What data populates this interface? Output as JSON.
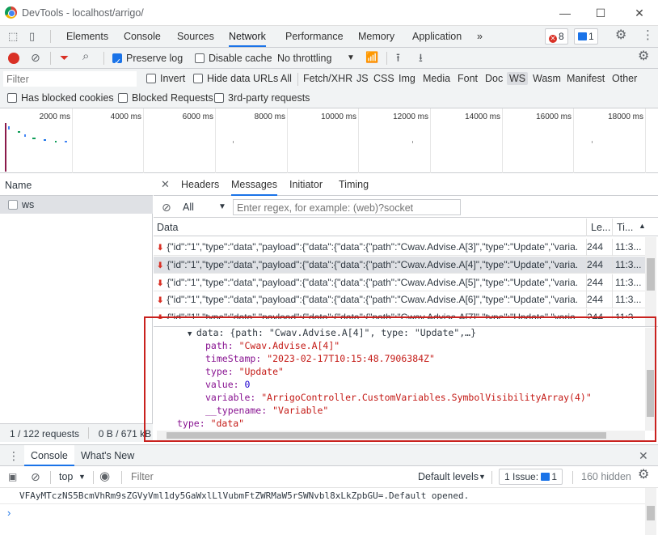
{
  "window": {
    "title": "DevTools - localhost/arrigo/"
  },
  "main_tabs": [
    "Elements",
    "Console",
    "Sources",
    "Network",
    "Performance",
    "Memory",
    "Application"
  ],
  "active_main_tab": "Network",
  "badges": {
    "errors": "8",
    "messages": "1"
  },
  "network_toolbar": {
    "preserve_log": "Preserve log",
    "disable_cache": "Disable cache",
    "throttling": "No throttling"
  },
  "filter": {
    "placeholder": "Filter",
    "invert": "Invert",
    "hide_data_urls": "Hide data URLs",
    "types": [
      "All",
      "Fetch/XHR",
      "JS",
      "CSS",
      "Img",
      "Media",
      "Font",
      "Doc",
      "WS",
      "Wasm",
      "Manifest",
      "Other"
    ],
    "selected_type": "WS",
    "has_blocked_cookies": "Has blocked cookies",
    "blocked_requests": "Blocked Requests",
    "third_party": "3rd-party requests"
  },
  "overview": {
    "ticks": [
      "2000 ms",
      "4000 ms",
      "6000 ms",
      "8000 ms",
      "10000 ms",
      "12000 ms",
      "14000 ms",
      "16000 ms",
      "18000 ms"
    ]
  },
  "request_list": {
    "header": "Name",
    "items": [
      "ws"
    ],
    "status": "1 / 122 requests",
    "transfer": "0 B / 671 kB t"
  },
  "detail_tabs": [
    "Headers",
    "Messages",
    "Initiator",
    "Timing"
  ],
  "active_detail_tab": "Messages",
  "messages_filter": {
    "type": "All",
    "placeholder": "Enter regex, for example: (web)?socket"
  },
  "messages_grid": {
    "columns": [
      "Data",
      "Le...",
      "Ti..."
    ],
    "rows": [
      {
        "data": "{\"id\":\"1\",\"type\":\"data\",\"payload\":{\"data\":{\"data\":{\"path\":\"Cwav.Advise.A[3]\",\"type\":\"Update\",\"varia...",
        "len": "244",
        "time": "11:3..."
      },
      {
        "data": "{\"id\":\"1\",\"type\":\"data\",\"payload\":{\"data\":{\"data\":{\"path\":\"Cwav.Advise.A[4]\",\"type\":\"Update\",\"varia...",
        "len": "244",
        "time": "11:3..."
      },
      {
        "data": "{\"id\":\"1\",\"type\":\"data\",\"payload\":{\"data\":{\"data\":{\"path\":\"Cwav.Advise.A[5]\",\"type\":\"Update\",\"varia...",
        "len": "244",
        "time": "11:3..."
      },
      {
        "data": "{\"id\":\"1\",\"type\":\"data\",\"payload\":{\"data\":{\"data\":{\"path\":\"Cwav.Advise.A[6]\",\"type\":\"Update\",\"varia...",
        "len": "244",
        "time": "11:3..."
      },
      {
        "data": "{\"id\":\"1\",\"type\":\"data\",\"payload\":{\"data\":{\"data\":{\"path\":\"Cwav.Advise.A[7]\",\"type\":\"Update\",\"varia...",
        "len": "244",
        "time": "11:3..."
      }
    ]
  },
  "json_view": {
    "data_line": "data: {path: \"Cwav.Advise.A[4]\", type: \"Update\",…}",
    "path_key": "path:",
    "path_val": "\"Cwav.Advise.A[4]\"",
    "ts_key": "timeStamp:",
    "ts_val": "\"2023-02-17T10:15:48.7906384Z\"",
    "type_key": "type:",
    "type_val": "\"Update\"",
    "value_key": "value:",
    "value_val": "0",
    "var_key": "variable:",
    "var_val": "\"ArrigoController.CustomVariables.SymbolVisibilityArray(4)\"",
    "typename_key": "__typename:",
    "typename_val": "\"Variable\"",
    "outer_type_key": "type:",
    "outer_type_val": "\"data\""
  },
  "drawer": {
    "tabs": [
      "Console",
      "What's New"
    ],
    "context": "top",
    "filter_placeholder": "Filter",
    "levels": "Default levels",
    "issues": "1 Issue:",
    "issues_count": "1",
    "hidden": "160 hidden",
    "log_line": "VFAyMTczNS5BcmVhRm9sZGVyVml1dy5GaWxlLlVubmFtZWRMaW5rSWNvbl8xLkZpbGU=.Default opened."
  }
}
